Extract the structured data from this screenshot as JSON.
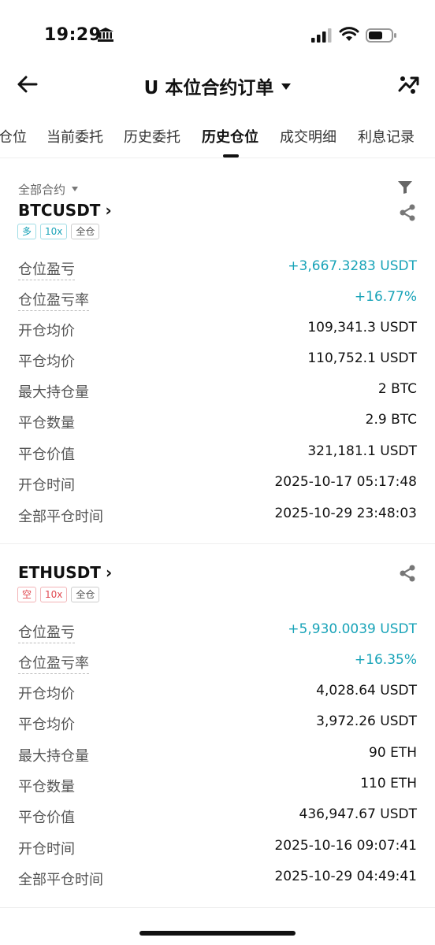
{
  "status_bar": {
    "time": "19:29"
  },
  "header": {
    "title": "U 本位合约订单"
  },
  "tabs": [
    {
      "label": "仓位"
    },
    {
      "label": "当前委托"
    },
    {
      "label": "历史委托"
    },
    {
      "label": "历史仓位",
      "active": true
    },
    {
      "label": "成交明细"
    },
    {
      "label": "利息记录"
    }
  ],
  "filter": {
    "label": "全部合约"
  },
  "positions": [
    {
      "symbol": "BTCUSDT",
      "side_tag": "多",
      "leverage_tag": "10x",
      "margin_tag": "全仓",
      "rows": [
        {
          "label": "仓位盈亏",
          "value": "+3,667.3283 USDT"
        },
        {
          "label": "仓位盈亏率",
          "value": "+16.77%"
        },
        {
          "label": "开仓均价",
          "value": "109,341.3 USDT"
        },
        {
          "label": "平仓均价",
          "value": "110,752.1 USDT"
        },
        {
          "label": "最大持仓量",
          "value": "2 BTC"
        },
        {
          "label": "平仓数量",
          "value": "2.9 BTC"
        },
        {
          "label": "平仓价值",
          "value": "321,181.1 USDT"
        },
        {
          "label": "开仓时间",
          "value": "2025-10-17 05:17:48"
        },
        {
          "label": "全部平仓时间",
          "value": "2025-10-29 23:48:03"
        }
      ]
    },
    {
      "symbol": "ETHUSDT",
      "side_tag": "空",
      "leverage_tag": "10x",
      "margin_tag": "全仓",
      "rows": [
        {
          "label": "仓位盈亏",
          "value": "+5,930.0039 USDT"
        },
        {
          "label": "仓位盈亏率",
          "value": "+16.35%"
        },
        {
          "label": "开仓均价",
          "value": "4,028.64 USDT"
        },
        {
          "label": "平仓均价",
          "value": "3,972.26 USDT"
        },
        {
          "label": "最大持仓量",
          "value": "90 ETH"
        },
        {
          "label": "平仓数量",
          "value": "110 ETH"
        },
        {
          "label": "平仓价值",
          "value": "436,947.67 USDT"
        },
        {
          "label": "开仓时间",
          "value": "2025-10-16 09:07:41"
        },
        {
          "label": "全部平仓时间",
          "value": "2025-10-29 04:49:41"
        }
      ]
    }
  ],
  "colors": {
    "positive": "#18a3b8",
    "short": "#e0474f"
  }
}
